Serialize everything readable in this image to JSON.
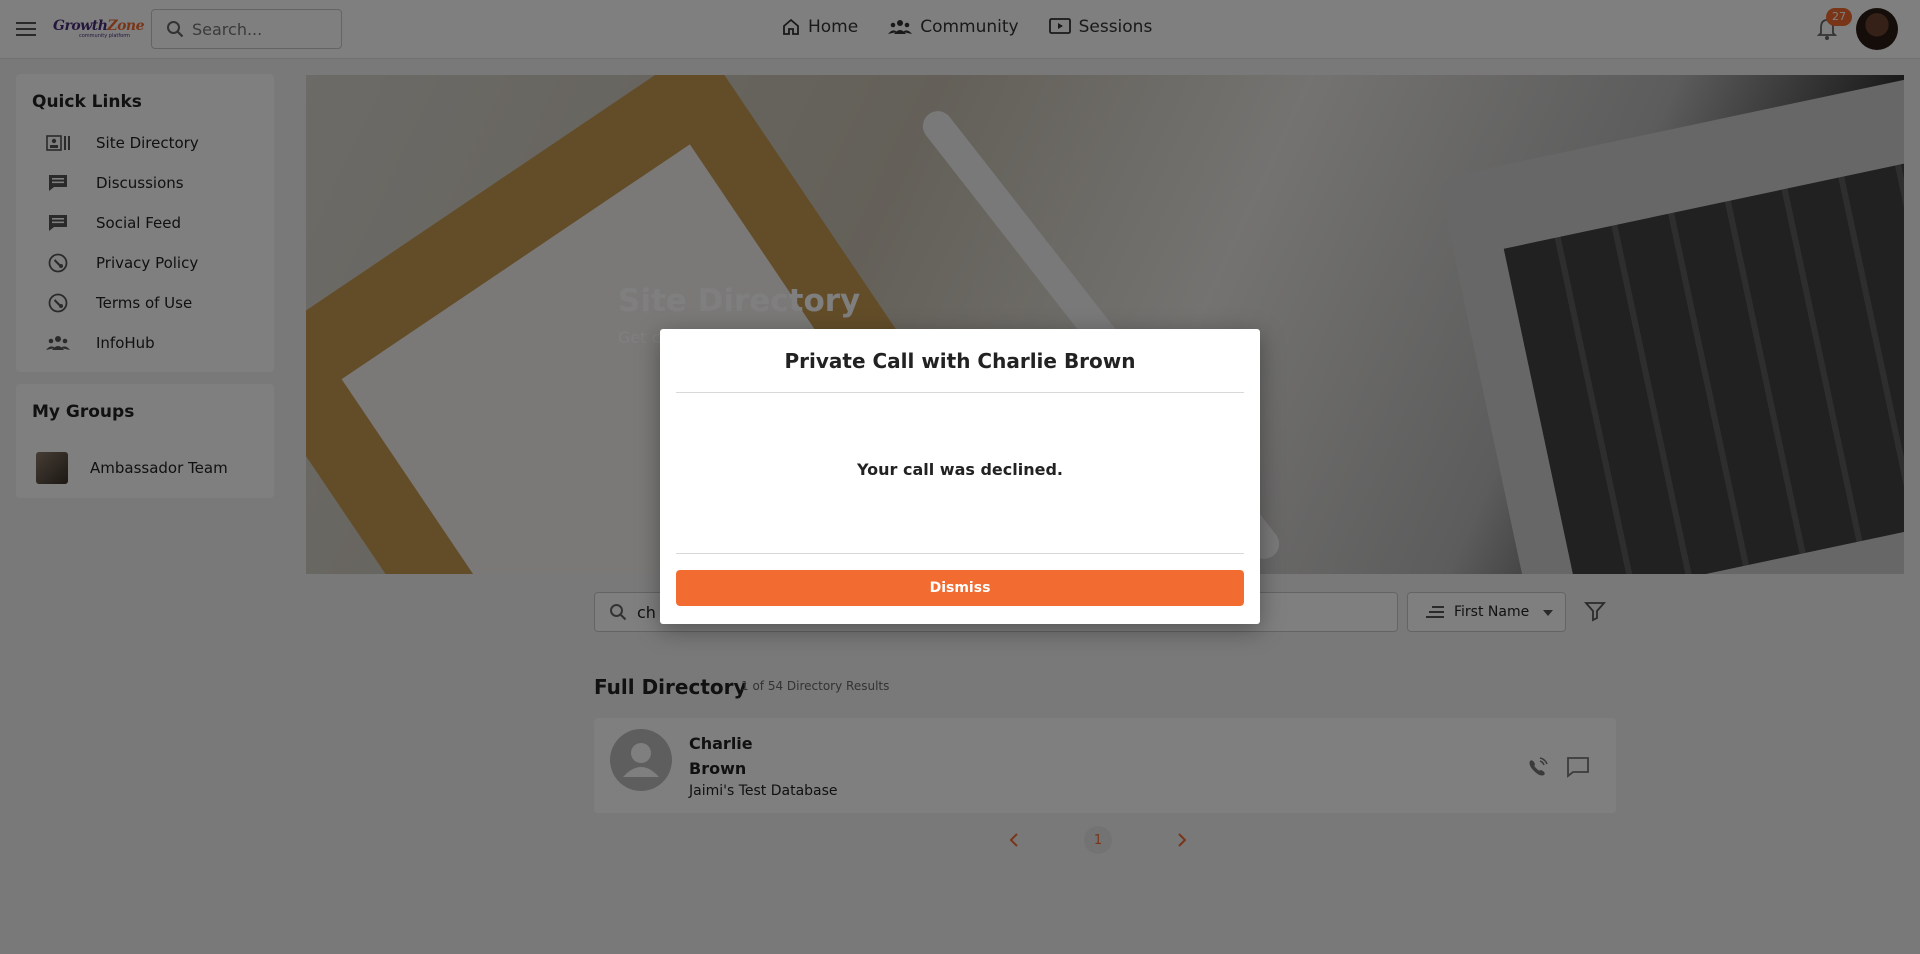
{
  "header": {
    "logo_brand_a": "Growth",
    "logo_brand_b": "Zone",
    "logo_sub": "community platform",
    "search_placeholder": "Search...",
    "nav": [
      {
        "label": "Home",
        "icon": "home-icon"
      },
      {
        "label": "Community",
        "icon": "community-icon"
      },
      {
        "label": "Sessions",
        "icon": "sessions-icon"
      }
    ],
    "notifications_count": "27"
  },
  "sidebar": {
    "quick_links_title": "Quick Links",
    "quick_links": [
      {
        "label": "Site Directory",
        "icon": "directory-icon"
      },
      {
        "label": "Discussions",
        "icon": "discussion-icon"
      },
      {
        "label": "Social Feed",
        "icon": "feed-icon"
      },
      {
        "label": "Privacy Policy",
        "icon": "policy-icon"
      },
      {
        "label": "Terms of Use",
        "icon": "terms-icon"
      },
      {
        "label": "InfoHub",
        "icon": "people-icon"
      }
    ],
    "groups_title": "My Groups",
    "groups": [
      {
        "label": "Ambassador Team"
      }
    ]
  },
  "hero": {
    "title": "Site Directory",
    "subtitle": "Get c"
  },
  "directory": {
    "search_value": "ch",
    "sort_label": "First Name",
    "section_title": "Full Directory",
    "results_text": "1 of 54 Directory Results",
    "rows": [
      {
        "first": "Charlie",
        "last": "Brown",
        "org": "Jaimi's Test Database"
      }
    ],
    "current_page": "1"
  },
  "modal": {
    "title": "Private Call with Charlie Brown",
    "message": "Your call was declined.",
    "dismiss_label": "Dismiss"
  },
  "colors": {
    "accent": "#f26b30",
    "brand_purple": "#4a2c7a"
  }
}
